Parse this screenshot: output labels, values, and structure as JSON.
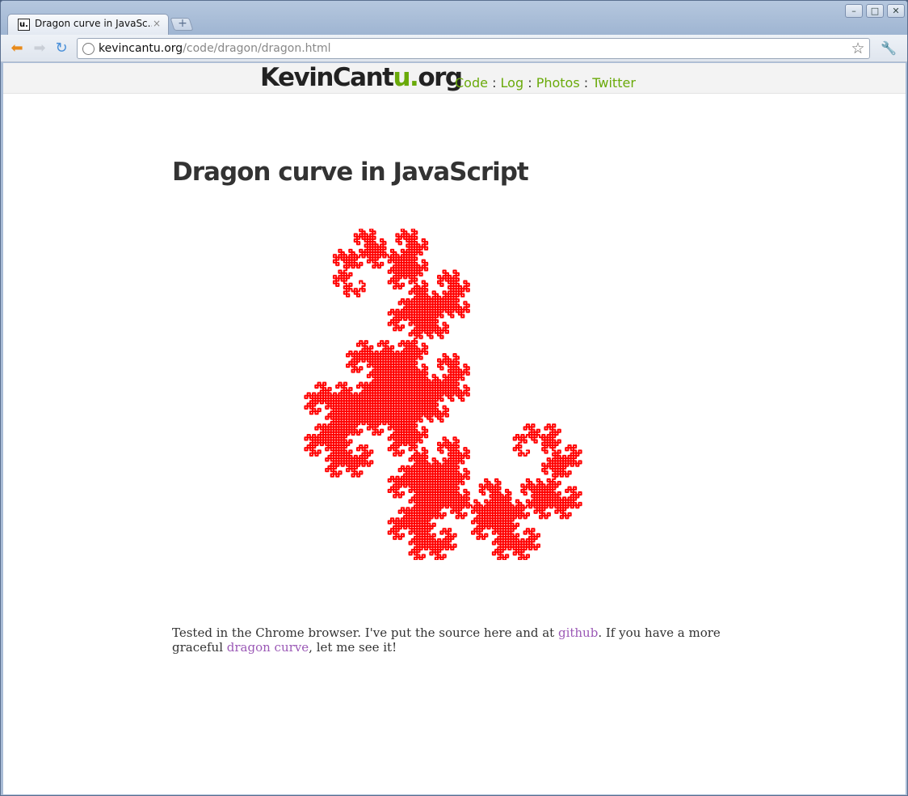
{
  "browser": {
    "tab_title": "Dragon curve in JavaSc...",
    "tab_favicon_text": "u.",
    "url_host": "kevincantu.org",
    "url_path": "/code/dragon/dragon.html"
  },
  "site": {
    "logo_prefix": "KevinCant",
    "logo_accent": "u.",
    "logo_suffix": "org",
    "nav": [
      "Code",
      "Log",
      "Photos",
      "Twitter"
    ],
    "nav_separator": ":"
  },
  "page": {
    "title": "Dragon curve in JavaScript",
    "para_part1": "Tested in the Chrome browser. I've put the source here and at ",
    "link_github": "github",
    "para_part2": ". If you have a more graceful ",
    "link_dragon": "dragon curve",
    "para_part3": ", let me see it!"
  },
  "colors": {
    "accent_green": "#6aaa0a",
    "link_purple": "#9b59b6",
    "curve_red": "#ff0000"
  },
  "icons": [
    "back-arrow-icon",
    "forward-arrow-icon",
    "reload-icon",
    "globe-icon",
    "star-icon",
    "wrench-icon",
    "close-icon",
    "new-tab-icon"
  ]
}
